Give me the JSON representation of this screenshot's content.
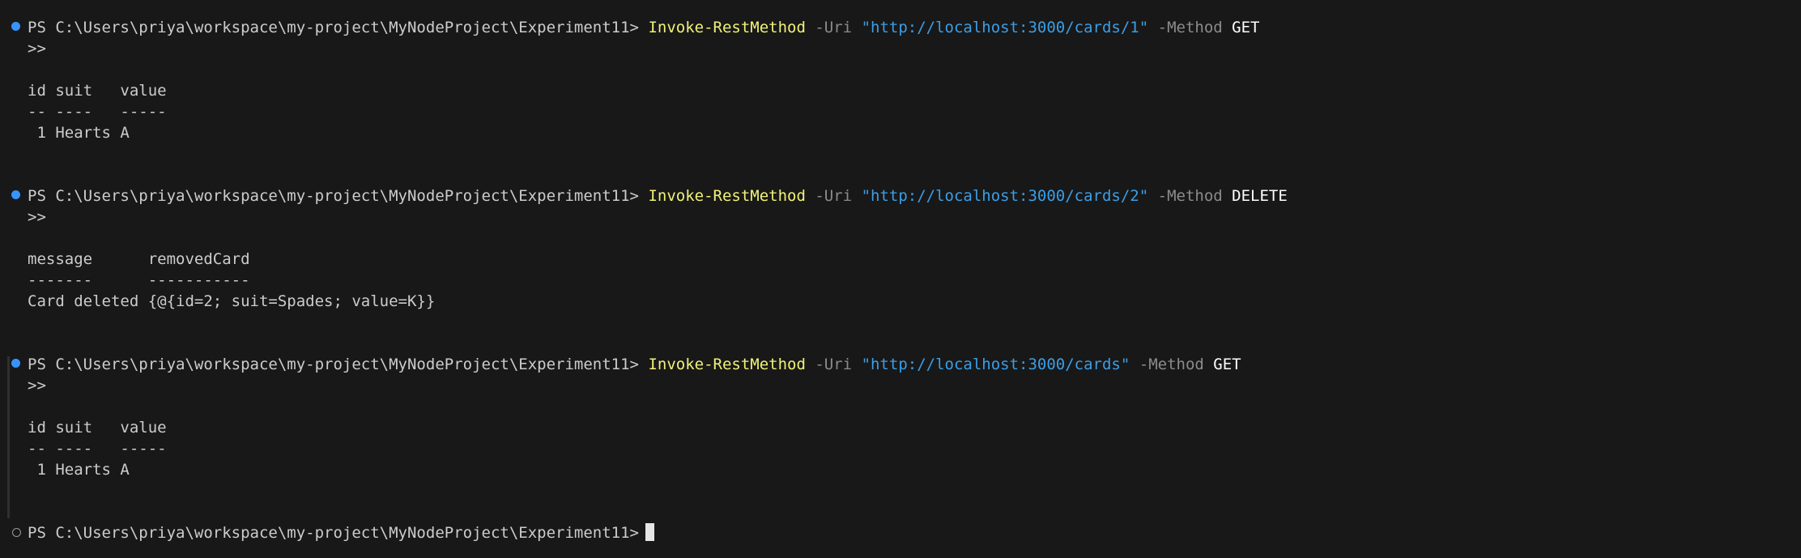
{
  "blocks": [
    {
      "prompt": "PS C:\\Users\\priya\\workspace\\my-project\\MyNodeProject\\Experiment11>",
      "command": "Invoke-RestMethod",
      "param_uri": "-Uri",
      "uri": "\"http://localhost:3000/cards/1\"",
      "param_method": "-Method",
      "method": "GET",
      "continuation": ">>",
      "output": [
        "id suit   value",
        "-- ----   -----",
        " 1 Hearts A"
      ]
    },
    {
      "prompt": "PS C:\\Users\\priya\\workspace\\my-project\\MyNodeProject\\Experiment11>",
      "command": "Invoke-RestMethod",
      "param_uri": "-Uri",
      "uri": "\"http://localhost:3000/cards/2\"",
      "param_method": "-Method",
      "method": "DELETE",
      "continuation": ">>",
      "output": [
        "message      removedCard",
        "-------      -----------",
        "Card deleted {@{id=2; suit=Spades; value=K}}"
      ]
    },
    {
      "prompt": "PS C:\\Users\\priya\\workspace\\my-project\\MyNodeProject\\Experiment11>",
      "command": "Invoke-RestMethod",
      "param_uri": "-Uri",
      "uri": "\"http://localhost:3000/cards\"",
      "param_method": "-Method",
      "method": "GET",
      "continuation": ">>",
      "output": [
        "id suit   value",
        "-- ----   -----",
        " 1 Hearts A"
      ]
    }
  ],
  "current_prompt": "PS C:\\Users\\priya\\workspace\\my-project\\MyNodeProject\\Experiment11>",
  "colors": {
    "background": "#181818",
    "text": "#cccccc",
    "command": "#f1f178",
    "parameter": "#8b8b8b",
    "string": "#3b9ee6",
    "argument": "#ffffff",
    "decoration_success": "#3794ff"
  },
  "icons": {
    "success_decoration": "filled-circle-decoration-icon",
    "pending_decoration": "hollow-circle-decoration-icon"
  }
}
